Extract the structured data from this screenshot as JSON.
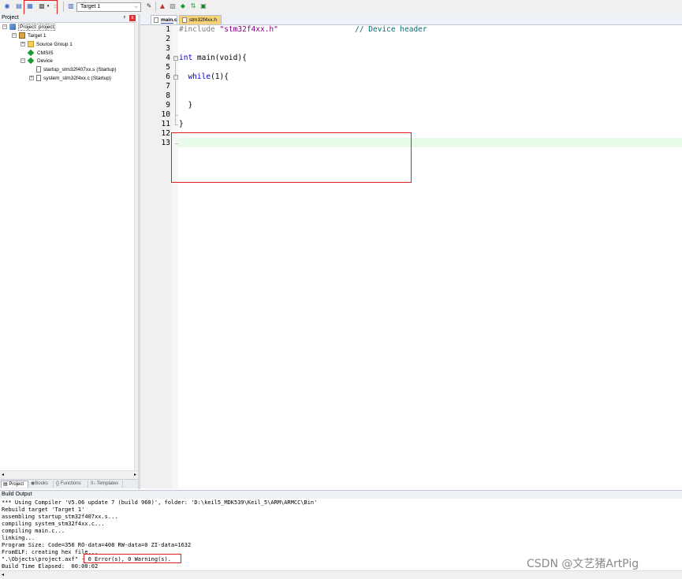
{
  "toolbar": {
    "target_value": "Target 1",
    "dropdown_arrow": "⌵"
  },
  "project_panel": {
    "title": "Project",
    "pin_glyph": "ᵖ",
    "close_glyph": "x",
    "tree": {
      "root": "Project: project",
      "target": "Target 1",
      "source_group": "Source Group 1",
      "cmsis": "CMSIS",
      "device": "Device",
      "file_startup": "startup_stm32f407xx.s (Startup)",
      "file_system": "system_stm32f4xx.c (Startup)"
    },
    "tabs": {
      "project": "Project",
      "books": "Books",
      "functions": "Functions",
      "templates": "Templates"
    }
  },
  "editor": {
    "tabs": {
      "main": "main.c",
      "header": "stm32f4xx.h"
    },
    "line_numbers": [
      "1",
      "2",
      "3",
      "4",
      "5",
      "6",
      "7",
      "8",
      "9",
      "10",
      "11",
      "12",
      "13"
    ],
    "code": {
      "l1_directive": "#include",
      "l1_string": "\"stm32f4xx.h\"",
      "l1_comment": "// Device header",
      "l4_type": "int",
      "l4_rest": " main(void){",
      "l6_kw": "while",
      "l6_rest": "(1){",
      "l9": "}",
      "l11": "}"
    }
  },
  "build_output": {
    "title": "Build Output",
    "lines": {
      "l1": "*** Using Compiler 'V5.06 update 7 (build 960)', folder: 'D:\\keil5_MDK539\\Keil_5\\ARM\\ARMCC\\Bin'",
      "l2": "Rebuild target 'Target 1'",
      "l3": "assembling startup_stm32f407xx.s...",
      "l4": "compiling system_stm32f4xx.c...",
      "l5": "compiling main.c...",
      "l6": "linking...",
      "l7": "Program Size: Code=356 RO-data=408 RW-data=0 ZI-data=1632",
      "l8": "FromELF: creating hex file...",
      "l9": "\".\\Objects\\project.axf\" - 0 Error(s), 0 Warning(s).",
      "l10": "Build Time Elapsed:  00:00:02"
    }
  },
  "watermark": "CSDN @文艺猪ArtPig",
  "colors": {
    "highlight_box": "#e02020",
    "keyword": "#0000c8",
    "string": "#800080",
    "comment": "#006c6c",
    "current_line": "#e8fbe8"
  }
}
